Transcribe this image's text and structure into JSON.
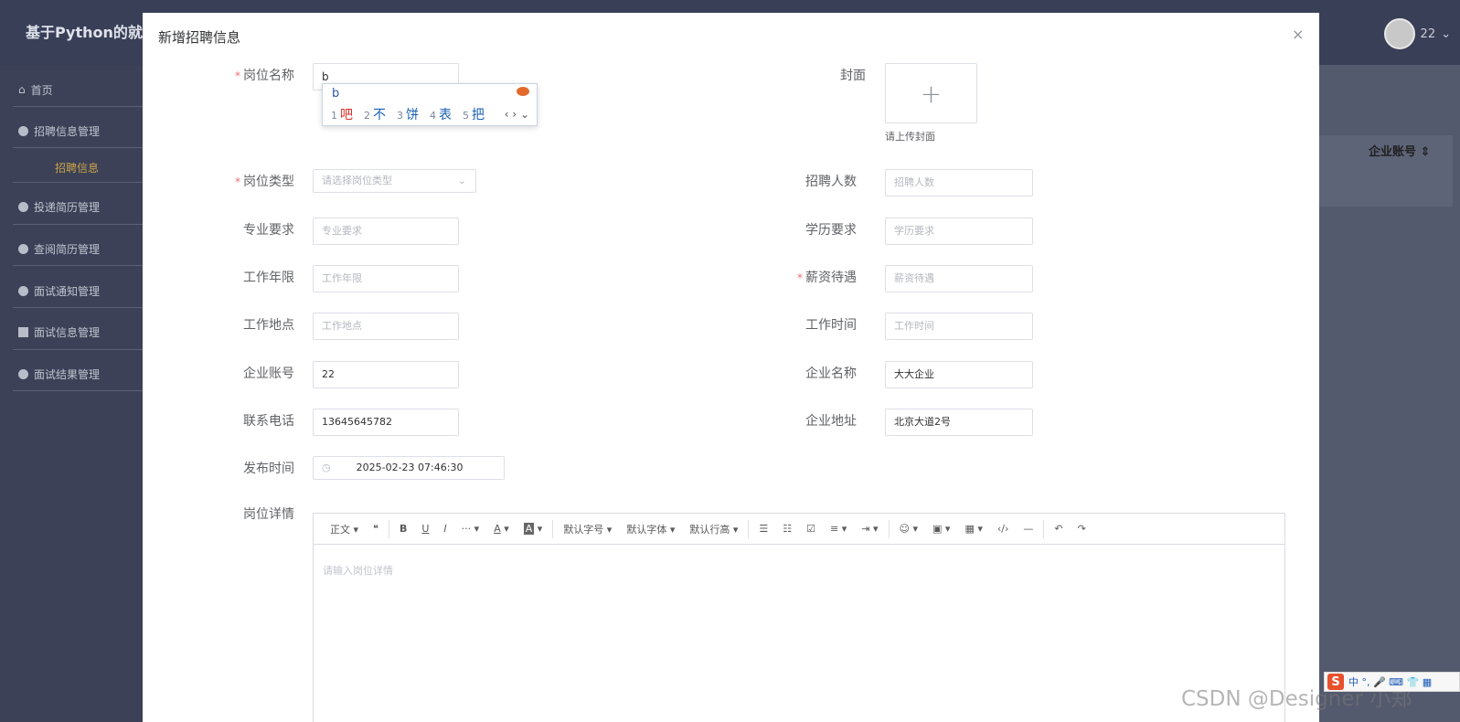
{
  "app": {
    "title": "基于Python的就",
    "user": "22"
  },
  "sidebar": {
    "items": [
      {
        "label": "首页",
        "icon": "home-icon"
      },
      {
        "label": "招聘信息管理",
        "icon": "dot-icon"
      },
      {
        "label": "招聘信息",
        "icon": ""
      },
      {
        "label": "投递简历管理",
        "icon": "dot-icon"
      },
      {
        "label": "查阅简历管理",
        "icon": "dot-icon"
      },
      {
        "label": "面试通知管理",
        "icon": "dot-icon"
      },
      {
        "label": "面试信息管理",
        "icon": "square-icon"
      },
      {
        "label": "面试结果管理",
        "icon": "dot-icon"
      }
    ]
  },
  "table": {
    "col_header": "企业账号 ⇕"
  },
  "dialog": {
    "title": "新增招聘信息",
    "close": "×",
    "fields": {
      "position_name": {
        "label": "岗位名称",
        "value": "b"
      },
      "cover": {
        "label": "封面",
        "plus": "+",
        "tip": "请上传封面"
      },
      "position_type": {
        "label": "岗位类型",
        "placeholder": "请选择岗位类型"
      },
      "headcount": {
        "label": "招聘人数",
        "placeholder": "招聘人数"
      },
      "major": {
        "label": "专业要求",
        "placeholder": "专业要求"
      },
      "education": {
        "label": "学历要求",
        "placeholder": "学历要求"
      },
      "work_years": {
        "label": "工作年限",
        "placeholder": "工作年限"
      },
      "salary": {
        "label": "薪资待遇",
        "placeholder": "薪资待遇"
      },
      "location": {
        "label": "工作地点",
        "placeholder": "工作地点"
      },
      "work_time": {
        "label": "工作时间",
        "placeholder": "工作时间"
      },
      "company_account": {
        "label": "企业账号",
        "value": "22"
      },
      "company_name": {
        "label": "企业名称",
        "value": "大大企业"
      },
      "phone": {
        "label": "联系电话",
        "value": "13645645782"
      },
      "company_address": {
        "label": "企业地址",
        "value": "北京大道2号"
      },
      "publish_time": {
        "label": "发布时间",
        "value": "2025-02-23 07:46:30"
      },
      "details": {
        "label": "岗位详情",
        "placeholder": "请输入岗位详情"
      }
    },
    "toolbar": {
      "paragraph": "正文",
      "quote": "❝",
      "bold": "B",
      "underline": "U",
      "italic": "I",
      "more": "···",
      "font_color": "A",
      "bg_color": "A",
      "font_size": "默认字号",
      "font_family": "默认字体",
      "line_height": "默认行高",
      "bullet_list": "☰",
      "numbered_list": "☷",
      "todo": "☑",
      "align": "≡",
      "indent": "⇥",
      "emoji": "☺",
      "image": "▣",
      "table": "▦",
      "code": "‹/›",
      "divider": "—",
      "undo": "↶",
      "redo": "↷"
    }
  },
  "ime": {
    "preedit": "b",
    "candidates": [
      {
        "n": "1",
        "text": "吧"
      },
      {
        "n": "2",
        "text": "不"
      },
      {
        "n": "3",
        "text": "饼"
      },
      {
        "n": "4",
        "text": "表"
      },
      {
        "n": "5",
        "text": "把"
      }
    ],
    "nav": "‹ › ⌄"
  },
  "watermark": "CSDN @Designer 小郑",
  "sogou": {
    "logo": "S",
    "text": "中 °, 🎤 ⌨ 👕 ▦"
  }
}
